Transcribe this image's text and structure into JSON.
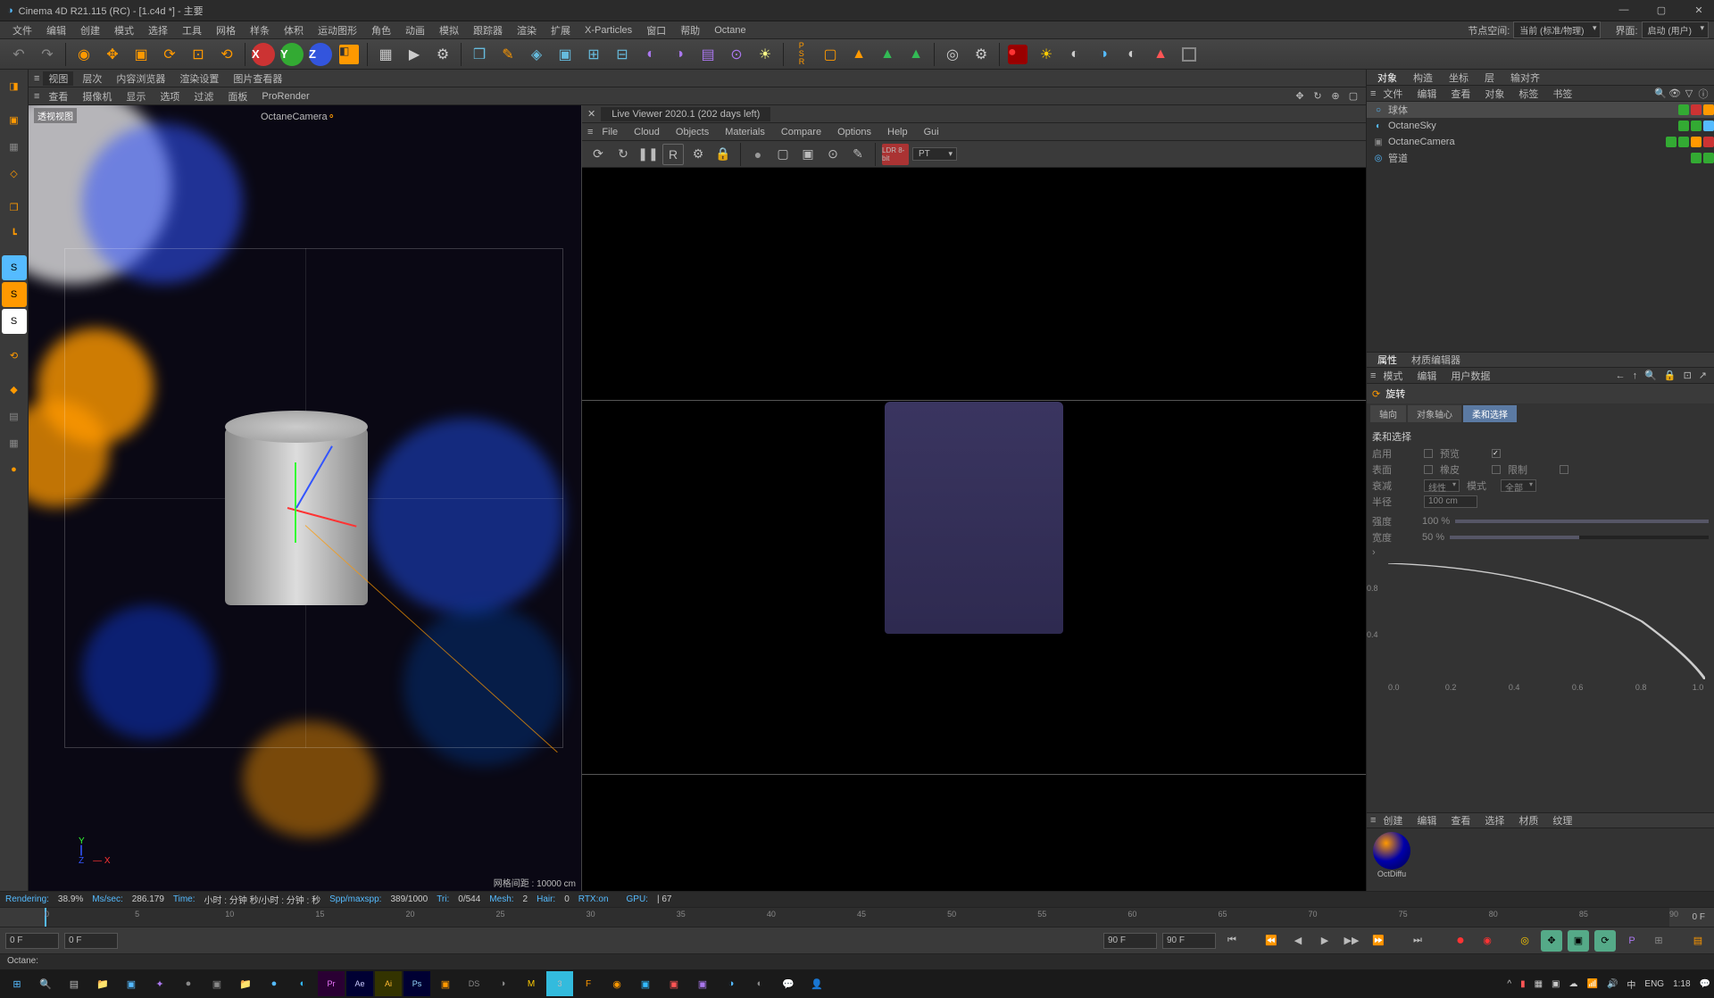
{
  "titlebar": {
    "title": "Cinema 4D R21.115 (RC) - [1.c4d *] - 主要"
  },
  "menu": {
    "items": [
      "文件",
      "编辑",
      "创建",
      "模式",
      "选择",
      "工具",
      "网格",
      "样条",
      "体积",
      "运动图形",
      "角色",
      "动画",
      "模拟",
      "跟踪器",
      "渲染",
      "扩展",
      "X-Particles",
      "窗口",
      "帮助",
      "Octane"
    ],
    "right_label1": "节点空间:",
    "right_drop1": "当前 (标准/物理)",
    "right_label2": "界面:",
    "right_drop2": "启动 (用户)"
  },
  "view": {
    "tabs": [
      "视图",
      "层次",
      "内容浏览器",
      "渲染设置",
      "图片查看器"
    ],
    "submenu": [
      "查看",
      "摄像机",
      "显示",
      "选项",
      "过滤",
      "面板",
      "ProRender"
    ],
    "label": "透视视图",
    "camera": "OctaneCamera",
    "camera_suffix": "⚬",
    "footer_label": "网格间距 : 10000 cm"
  },
  "live": {
    "tab": "Live Viewer 2020.1 (202 days left)",
    "menu": [
      "File",
      "Cloud",
      "Objects",
      "Materials",
      "Compare",
      "Options",
      "Help",
      "Gui"
    ],
    "ldr": "LDR\n8-bit",
    "pt": "PT"
  },
  "panel_tabs": [
    "对象",
    "构造",
    "坐标",
    "层",
    "输对齐"
  ],
  "obj_menu": [
    "文件",
    "编辑",
    "查看",
    "对象",
    "标签",
    "书签"
  ],
  "objects": [
    {
      "name": "球体",
      "icon": "○",
      "iconColor": "#5bf",
      "tags": [
        {
          "c": "#3a3"
        },
        {
          "c": "#c33"
        },
        {
          "c": "#f90"
        }
      ],
      "selected": true
    },
    {
      "name": "OctaneSky",
      "icon": "◐",
      "iconColor": "#5bf",
      "tags": [
        {
          "c": "#3a3"
        },
        {
          "c": "#3a3"
        },
        {
          "c": "#5bf"
        }
      ]
    },
    {
      "name": "OctaneCamera",
      "icon": "▣",
      "iconColor": "#888",
      "tags": [
        {
          "c": "#3a3"
        },
        {
          "c": "#3a3"
        },
        {
          "c": "#f90"
        },
        {
          "c": "#c33"
        }
      ]
    },
    {
      "name": "管道",
      "icon": "◎",
      "iconColor": "#5bf",
      "tags": [
        {
          "c": "#3a3"
        },
        {
          "c": "#3a3"
        }
      ]
    }
  ],
  "attr": {
    "header_tabs": [
      "属性",
      "材质编辑器"
    ],
    "menu": [
      "模式",
      "编辑",
      "用户数据"
    ],
    "title": "旋转",
    "subtabs": [
      {
        "l": "轴向"
      },
      {
        "l": "对象轴心"
      },
      {
        "l": "柔和选择",
        "a": true
      }
    ],
    "section": "柔和选择",
    "rows": {
      "enable": "启用",
      "preview": "预览",
      "surface": "表面",
      "rubber": "橡皮",
      "limit": "限制",
      "falloff": "衰减",
      "falloff_v": "线性",
      "mode": "模式",
      "mode_v": "全部",
      "radius": "半径",
      "radius_v": "100 cm",
      "strength": "强度",
      "strength_v": "100 %",
      "width": "宽度",
      "width_v": "50 %"
    },
    "graph_y": [
      "0.8",
      "0.4"
    ],
    "graph_x": [
      "0.0",
      "0.2",
      "0.4",
      "0.6",
      "0.8",
      "1.0"
    ]
  },
  "mat": {
    "menu": [
      "创建",
      "编辑",
      "查看",
      "选择",
      "材质",
      "纹理"
    ],
    "item": "OctDiffu"
  },
  "status": {
    "items": [
      [
        "Rendering:",
        "38.9%"
      ],
      [
        "Ms/sec:",
        "286.179"
      ],
      [
        "Time:",
        "小时 : 分钟 秒/小时 : 分钟 : 秒"
      ],
      [
        "Spp/maxspp:",
        "389/1000"
      ],
      [
        "Tri:",
        "0/544"
      ],
      [
        "Mesh:",
        "2"
      ],
      [
        "Hair:",
        "0"
      ],
      [
        "RTX:on",
        ""
      ],
      [
        "GPU:",
        "|  67"
      ]
    ]
  },
  "timeline": {
    "ticks": [
      "0",
      "5",
      "10",
      "15",
      "20",
      "25",
      "30",
      "35",
      "40",
      "45",
      "50",
      "55",
      "60",
      "65",
      "70",
      "75",
      "80",
      "85",
      "90"
    ],
    "end": "0 F"
  },
  "transport": {
    "start": "0 F",
    "pos": "0 F",
    "end1": "90 F",
    "end2": "90 F"
  },
  "hint": "Octane:",
  "tray": {
    "lang": "ENG",
    "time": "1:18"
  }
}
